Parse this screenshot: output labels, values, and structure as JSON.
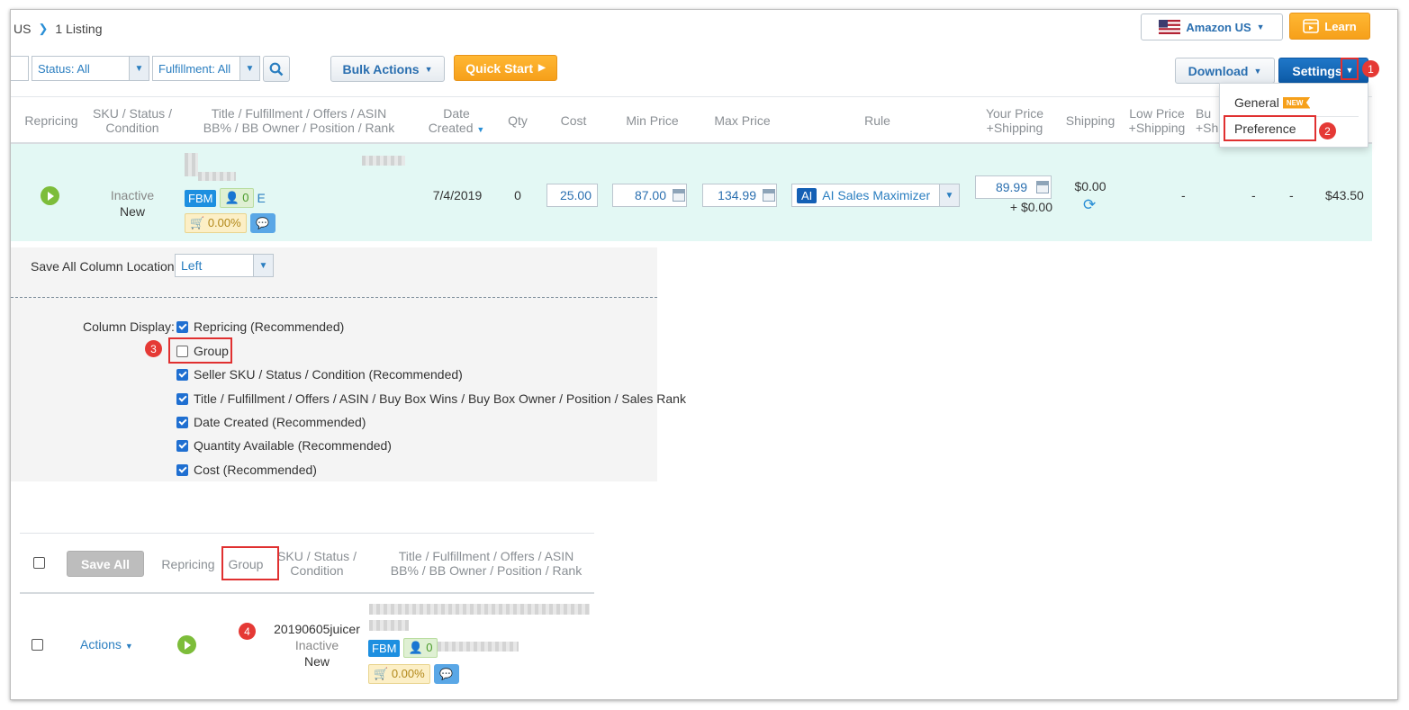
{
  "breadcrumb": {
    "country": "US",
    "listing_count": "1 Listing"
  },
  "header": {
    "marketplace": "Amazon US",
    "learn": "Learn",
    "download": "Download",
    "settings": "Settings"
  },
  "filters": {
    "status": "Status: All",
    "fulfillment": "Fulfillment: All",
    "bulk_actions": "Bulk Actions",
    "quick_start": "Quick Start"
  },
  "settings_menu": {
    "general": "General",
    "general_badge": "NEW",
    "preference": "Preference"
  },
  "steps": [
    "1",
    "2",
    "3",
    "4"
  ],
  "columns": {
    "repricing": "Repricing",
    "sku_l1": "SKU / Status /",
    "sku_l2": "Condition",
    "title_l1": "Title / Fulfillment / Offers / ASIN",
    "title_l2": "BB% / BB Owner / Position / Rank",
    "date_l1": "Date",
    "date_l2": "Created",
    "qty": "Qty",
    "cost": "Cost",
    "min_price": "Min Price",
    "max_price": "Max Price",
    "rule": "Rule",
    "your_price_l1": "Your Price",
    "your_price_l2": "+Shipping",
    "shipping": "Shipping",
    "low_price_l1": "Low Price",
    "low_price_l2": "+Shipping",
    "bb_l1": "Bu",
    "bb_l2": "+Sh"
  },
  "row": {
    "status": "Inactive",
    "condition": "New",
    "fbm": "FBM",
    "offers": "0",
    "offers_suffix": "E",
    "bb_pct": "0.00%",
    "date_created": "7/4/2019",
    "qty": "0",
    "cost": "25.00",
    "min_price": "87.00",
    "max_price": "134.99",
    "rule_badge": "AI",
    "rule_name": "AI Sales Maximizer",
    "your_price": "89.99",
    "your_price_shipping": "+ $0.00",
    "shipping": "$0.00",
    "low_price": "-",
    "bb_price": "-",
    "extra": "-",
    "last_col": "$43.50"
  },
  "preferences": {
    "save_all_label": "Save All Column Location:",
    "location_value": "Left",
    "column_display_label": "Column Display:",
    "options": [
      {
        "label": "Repricing (Recommended)",
        "checked": true
      },
      {
        "label": "Group",
        "checked": false
      },
      {
        "label": "Seller SKU / Status / Condition (Recommended)",
        "checked": true
      },
      {
        "label": "Title / Fulfillment / Offers / ASIN / Buy Box Wins / Buy Box Owner / Position / Sales Rank",
        "checked": true
      },
      {
        "label": "Date Created (Recommended)",
        "checked": true
      },
      {
        "label": "Quantity Available (Recommended)",
        "checked": true
      },
      {
        "label": "Cost (Recommended)",
        "checked": true
      }
    ]
  },
  "preview": {
    "save_all": "Save All",
    "repricing": "Repricing",
    "group": "Group",
    "sku_l1": "SKU / Status /",
    "sku_l2": "Condition",
    "title_l1": "Title / Fulfillment / Offers / ASIN",
    "title_l2": "BB% / BB Owner / Position / Rank",
    "actions": "Actions",
    "sku": "20190605juicer",
    "status": "Inactive",
    "condition": "New",
    "fbm": "FBM",
    "offers": "0",
    "bb_pct": "0.00%"
  }
}
